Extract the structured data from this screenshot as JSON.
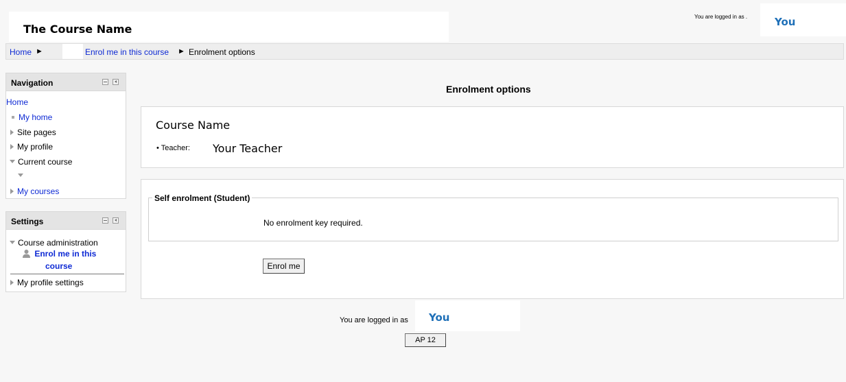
{
  "header": {
    "course_title": "The Course Name",
    "login_text": "You are logged in as .",
    "user_name": "You"
  },
  "breadcrumb": {
    "home": "Home",
    "separator": "►",
    "enrol_link": "Enrol me in this course",
    "current": "Enrolment options"
  },
  "navigation": {
    "title": "Navigation",
    "home": "Home",
    "items": [
      "My home",
      "Site pages",
      "My profile",
      "Current course",
      "My courses"
    ]
  },
  "settings": {
    "title": "Settings",
    "course_admin": "Course administration",
    "enrol_line1": "Enrol me in this",
    "enrol_line2": "course",
    "profile_settings": "My profile settings"
  },
  "main": {
    "heading": "Enrolment options",
    "course_name": "Course Name",
    "teacher_label": "Teacher:",
    "teacher_name": "Your Teacher",
    "self_enrol_legend": "Self enrolment (Student)",
    "no_key_text": "No enrolment key required.",
    "enrol_button": "Enrol me"
  },
  "footer": {
    "login_text": "You are logged in as",
    "user_name": "You",
    "course_button": "AP 12"
  },
  "colors": {
    "link": "#0e2ad4",
    "user_name": "#1f70b8",
    "block_header": "#e4e4e4",
    "page_bg": "#f7f7f7"
  }
}
